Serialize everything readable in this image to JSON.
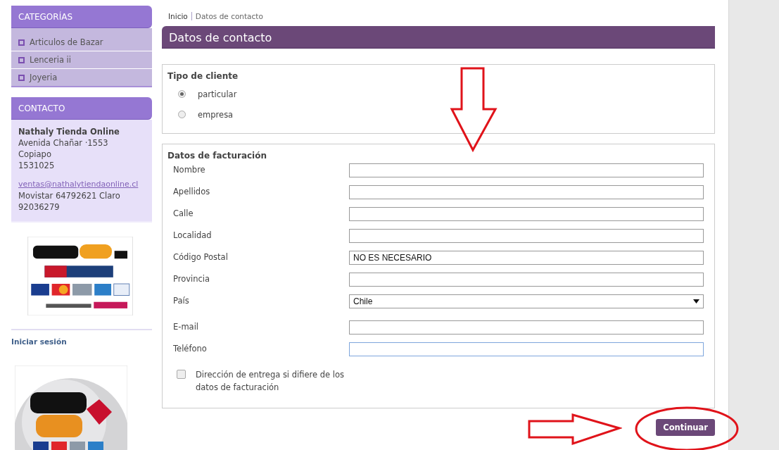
{
  "sidebar": {
    "categories": {
      "title": "CATEGORÍAS",
      "items": [
        {
          "label": "Articulos de Bazar"
        },
        {
          "label": "Lenceria ii"
        },
        {
          "label": "Joyeria"
        }
      ]
    },
    "contact": {
      "title": "CONTACTO",
      "name": "Nathaly Tienda Online",
      "lines": [
        "Avenida Chañar ·1553",
        "Copiapo",
        "1531025"
      ],
      "email": "ventas@nathalytiendaonline.cl",
      "phone_lines": [
        "Movistar 64792621 Claro",
        "92036279"
      ]
    },
    "login_link": "Iniciar sesión"
  },
  "breadcrumb": [
    "Inicio",
    "Datos de contacto"
  ],
  "page_title": "Datos de contacto",
  "client_type": {
    "legend": "Tipo de cliente",
    "options": [
      {
        "label": "particular",
        "selected": true
      },
      {
        "label": "empresa",
        "selected": false
      }
    ]
  },
  "billing": {
    "legend": "Datos de facturación",
    "fields": [
      {
        "label": "Nombre",
        "kind": "text",
        "focused": false
      },
      {
        "label": "Apellidos",
        "kind": "text",
        "focused": false
      },
      {
        "label": "Calle",
        "kind": "text",
        "focused": false
      },
      {
        "label": "Localidad",
        "kind": "text",
        "focused": false
      },
      {
        "label": "Código Postal",
        "kind": "text",
        "value": "NO ES NECESARIO",
        "focused": false
      },
      {
        "label": "Provincia",
        "kind": "text",
        "focused": false
      },
      {
        "label": "País",
        "kind": "select",
        "value": "Chile",
        "focused": false
      },
      {
        "label": "E-mail",
        "kind": "text",
        "focused": false
      },
      {
        "label": "Teléfono",
        "kind": "text",
        "focused": true
      }
    ],
    "checkbox": {
      "label": "Dirección de entrega si difiere de los datos de facturación",
      "checked": false
    }
  },
  "button": "Continuar",
  "annotations": [
    {
      "kind": "arrow-down"
    },
    {
      "kind": "arrow-right"
    },
    {
      "kind": "ellipse"
    }
  ]
}
